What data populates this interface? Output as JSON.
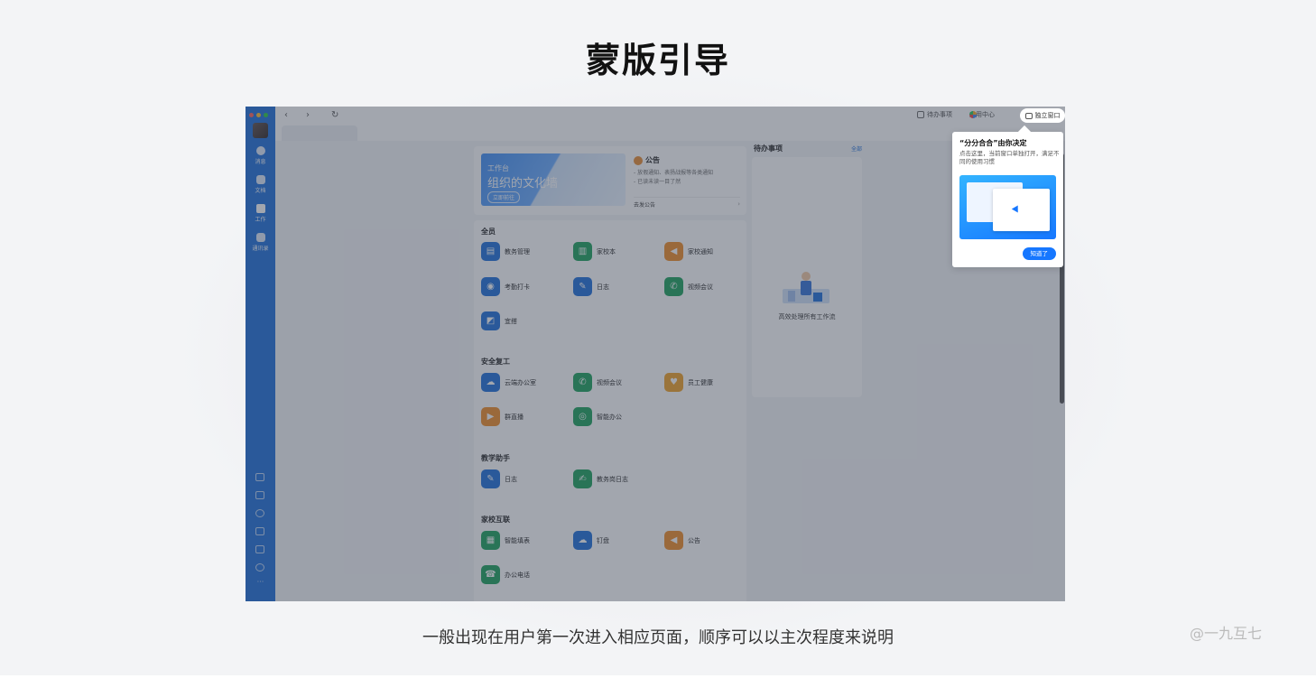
{
  "page": {
    "title": "蒙版引导",
    "caption": "一般出现在用户第一次进入相应页面，顺序可以以主次程度来说明",
    "watermark": "@一九互七"
  },
  "sidebar": {
    "items": [
      {
        "label": "消息",
        "icon": "message-icon"
      },
      {
        "label": "文档",
        "icon": "document-icon"
      },
      {
        "label": "工作",
        "icon": "workbench-icon"
      },
      {
        "label": "通讯录",
        "icon": "contacts-icon"
      }
    ],
    "bottom_icons": [
      "calendar-icon",
      "todo-icon",
      "ding-icon",
      "phone-icon",
      "mail-icon",
      "plugin-icon"
    ],
    "more_label": "···"
  },
  "toolbar": {
    "back": "‹",
    "forward": "›",
    "refresh": "↻",
    "todo_label": "待办事项",
    "app_center_label": "应用中心",
    "window_label": "独立窗口"
  },
  "banner": {
    "subtitle": "工作台",
    "title": "组织的文化墙",
    "button": "立即前往"
  },
  "notice": {
    "title": "公告",
    "lines": [
      "- 放假通知、表扬战报等各类通知",
      "- 已读未读一目了然"
    ],
    "send": "去发公告",
    "chevron": "›"
  },
  "sections": [
    {
      "title": "全员",
      "apps": [
        {
          "label": "教务管理",
          "color": "#1a6cd8",
          "icon": "edu-manage-icon"
        },
        {
          "label": "家校本",
          "color": "#18a058",
          "icon": "homework-icon"
        },
        {
          "label": "家校通知",
          "color": "#f08a24",
          "icon": "notify-icon"
        },
        {
          "label": "考勤打卡",
          "color": "#1a6cd8",
          "icon": "location-icon"
        },
        {
          "label": "日志",
          "color": "#1a6cd8",
          "icon": "log-icon"
        },
        {
          "label": "视频会议",
          "color": "#18a058",
          "icon": "video-call-icon"
        },
        {
          "label": "宜搭",
          "color": "#1a6cd8",
          "icon": "yida-icon"
        }
      ]
    },
    {
      "title": "安全复工",
      "apps": [
        {
          "label": "云端办公室",
          "color": "#1a6cd8",
          "icon": "cloud-office-icon"
        },
        {
          "label": "视频会议",
          "color": "#18a058",
          "icon": "video-call-icon"
        },
        {
          "label": "员工健康",
          "color": "#f0a024",
          "icon": "health-icon"
        },
        {
          "label": "群直播",
          "color": "#f08a24",
          "icon": "live-icon"
        },
        {
          "label": "智能办公",
          "color": "#18a058",
          "icon": "smart-office-icon"
        }
      ]
    },
    {
      "title": "教学助手",
      "apps": [
        {
          "label": "日志",
          "color": "#1a6cd8",
          "icon": "log-icon"
        },
        {
          "label": "教务岗日志",
          "color": "#18a058",
          "icon": "edu-log-icon"
        }
      ]
    },
    {
      "title": "家校互联",
      "apps": [
        {
          "label": "智能填表",
          "color": "#18a058",
          "icon": "form-icon"
        },
        {
          "label": "钉盘",
          "color": "#1a6cd8",
          "icon": "drive-icon"
        },
        {
          "label": "公告",
          "color": "#f08a24",
          "icon": "announce-icon"
        },
        {
          "label": "办公电话",
          "color": "#18a058",
          "icon": "office-phone-icon"
        }
      ]
    }
  ],
  "todo": {
    "title": "待办事项",
    "all_link": "全部",
    "empty_text": "高效处理所有工作流"
  },
  "popover": {
    "title": "“分分合合”由你决定",
    "desc": "点击这里，当前窗口单独打开，满足不同的使用习惯",
    "button": "知道了"
  },
  "colors": {
    "sidebar": "#1a6cd8",
    "accent": "#1677ff",
    "mask": "rgba(60,68,86,0.48)"
  }
}
